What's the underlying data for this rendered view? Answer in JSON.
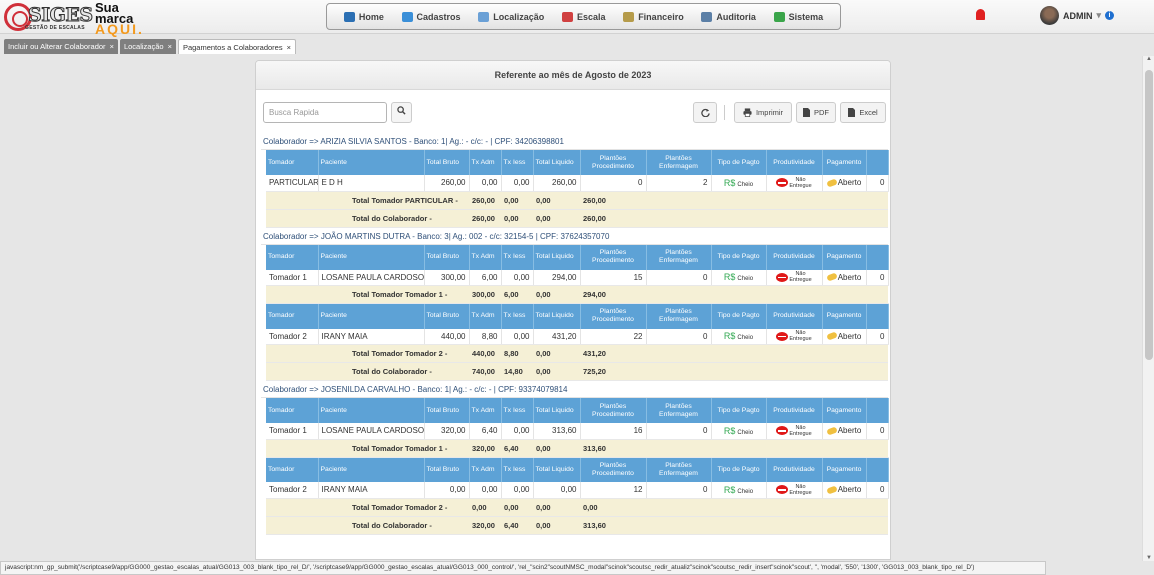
{
  "logo": {
    "word": "SIGES",
    "subtitle": "GESTÃO DE ESCALAS",
    "line1": "Sua",
    "line2": "marca",
    "line3": "AQUI."
  },
  "nav": [
    {
      "label": "Home",
      "icon": "home-icon",
      "color": "#2b6fb3"
    },
    {
      "label": "Cadastros",
      "icon": "folder-icon",
      "color": "#3a8fd8"
    },
    {
      "label": "Localização",
      "icon": "user-location-icon",
      "color": "#6aa0d6"
    },
    {
      "label": "Escala",
      "icon": "calendar-icon",
      "color": "#d04040"
    },
    {
      "label": "Financeiro",
      "icon": "money-icon",
      "color": "#b59b4a"
    },
    {
      "label": "Auditoria",
      "icon": "magnifier-icon",
      "color": "#5b7fa6"
    },
    {
      "label": "Sistema",
      "icon": "gear-icon",
      "color": "#3aa54a"
    }
  ],
  "user": {
    "name": "ADMIN",
    "caret": "▾",
    "info": "i"
  },
  "tabs": [
    {
      "label": "Incluir ou Alterar Colaborador",
      "close": "×"
    },
    {
      "label": "Localização",
      "close": "×"
    },
    {
      "label": "Pagamentos a Colaboradores",
      "close": "×"
    }
  ],
  "panel": {
    "title": "Referente ao mês de Agosto de 2023"
  },
  "search": {
    "placeholder": "Busca Rapida"
  },
  "toolbar": {
    "print": "Imprimir",
    "pdf": "PDF",
    "excel": "Excel"
  },
  "headers": [
    "Tomador",
    "Paciente",
    "Total Bruto",
    "Tx Adm",
    "Tx Iess",
    "Total Liquido",
    "Plantões Procedimento",
    "Plantões Enfermagem",
    "Tipo de Pagto",
    "Produtividade",
    "Pagamento",
    ""
  ],
  "cells": {
    "tipo": "R$",
    "tipo_sub": "Cheio",
    "prod_1": "Não",
    "prod_2": "Entregue",
    "pag": "Aberto"
  },
  "collaborators": [
    {
      "label": "Colaborador => ARIZIA SILVIA SANTOS - Banco: 1| Ag.: - c/c: - | CPF: 34206398801",
      "groups": [
        {
          "row": {
            "tomador": "PARTICULAR",
            "paciente": "E D H",
            "bruto": "260,00",
            "adm": "0,00",
            "iess": "0,00",
            "liquido": "260,00",
            "proc": "0",
            "enf": "2",
            "last": "0"
          },
          "total": {
            "label": "Total Tomador PARTICULAR -",
            "bruto": "260,00",
            "adm": "0,00",
            "iess": "0,00",
            "liquido": "260,00"
          }
        }
      ],
      "total": {
        "label": "Total do Colaborador -",
        "bruto": "260,00",
        "adm": "0,00",
        "iess": "0,00",
        "liquido": "260,00"
      }
    },
    {
      "label": "Colaborador => JOÃO MARTINS DUTRA - Banco: 3| Ag.: 002 - c/c: 32154-5 | CPF: 37624357070",
      "groups": [
        {
          "row": {
            "tomador": "Tomador 1",
            "paciente": "LOSANE PAULA CARDOSO",
            "bruto": "300,00",
            "adm": "6,00",
            "iess": "0,00",
            "liquido": "294,00",
            "proc": "15",
            "enf": "0",
            "last": "0"
          },
          "total": {
            "label": "Total Tomador Tomador 1 -",
            "bruto": "300,00",
            "adm": "6,00",
            "iess": "0,00",
            "liquido": "294,00"
          }
        },
        {
          "row": {
            "tomador": "Tomador 2",
            "paciente": "IRANY MAIA",
            "bruto": "440,00",
            "adm": "8,80",
            "iess": "0,00",
            "liquido": "431,20",
            "proc": "22",
            "enf": "0",
            "last": "0"
          },
          "total": {
            "label": "Total Tomador Tomador 2 -",
            "bruto": "440,00",
            "adm": "8,80",
            "iess": "0,00",
            "liquido": "431,20"
          }
        }
      ],
      "total": {
        "label": "Total do Colaborador -",
        "bruto": "740,00",
        "adm": "14,80",
        "iess": "0,00",
        "liquido": "725,20"
      }
    },
    {
      "label": "Colaborador => JOSENILDA CARVALHO - Banco: 1| Ag.: - c/c: - | CPF: 93374079814",
      "groups": [
        {
          "row": {
            "tomador": "Tomador 1",
            "paciente": "LOSANE PAULA CARDOSO",
            "bruto": "320,00",
            "adm": "6,40",
            "iess": "0,00",
            "liquido": "313,60",
            "proc": "16",
            "enf": "0",
            "last": "0"
          },
          "total": {
            "label": "Total Tomador Tomador 1 -",
            "bruto": "320,00",
            "adm": "6,40",
            "iess": "0,00",
            "liquido": "313,60"
          }
        },
        {
          "row": {
            "tomador": "Tomador 2",
            "paciente": "IRANY MAIA",
            "bruto": "0,00",
            "adm": "0,00",
            "iess": "0,00",
            "liquido": "0,00",
            "proc": "12",
            "enf": "0",
            "last": "0"
          },
          "total": {
            "label": "Total Tomador Tomador 2 -",
            "bruto": "0,00",
            "adm": "0,00",
            "iess": "0,00",
            "liquido": "0,00"
          }
        }
      ],
      "total": {
        "label": "Total do Colaborador -",
        "bruto": "320,00",
        "adm": "6,40",
        "iess": "0,00",
        "liquido": "313,60"
      }
    }
  ],
  "status": "javascript:nm_gp_submit('/scriptcase9/app/GG000_gestao_escalas_atual/GG013_003_blank_tipo_rel_D/', '/scriptcase9/app/GG000_gestao_escalas_atual/GG013_000_control/', 'rel_\"scin2\"scoutNMSC_modal\"scinok\"scoutsc_redir_atualiz\"scinok\"scoutsc_redir_insert\"scinok\"scout', '', 'modal', '550', '1300', 'GG013_003_blank_tipo_rel_D')"
}
